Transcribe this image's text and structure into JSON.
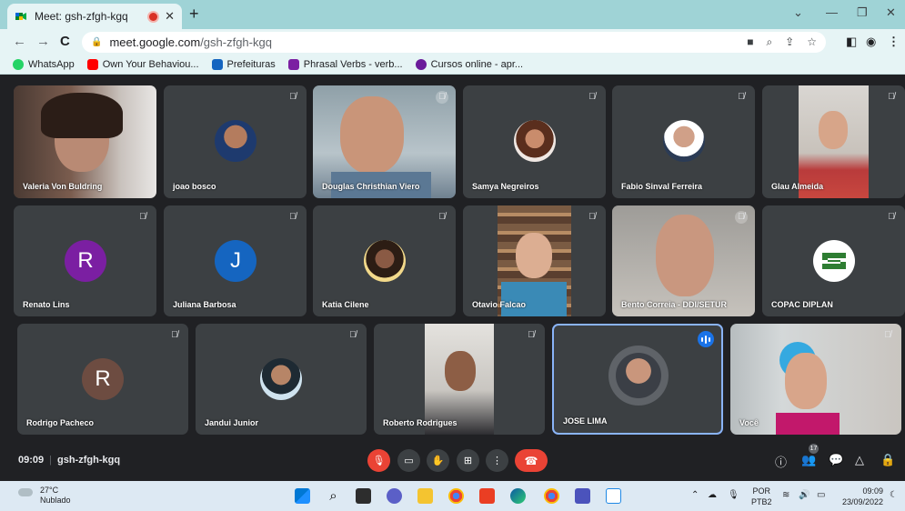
{
  "browser": {
    "tab_title": "Meet: gsh-zfgh-kgq",
    "tab_close": "✕",
    "new_tab": "+",
    "url_host": "meet.google.com",
    "url_path": "/gsh-zfgh-kgq",
    "bookmarks": [
      {
        "label": "WhatsApp",
        "color": "#25d366"
      },
      {
        "label": "Own Your Behaviou...",
        "color": "#ff0000"
      },
      {
        "label": "Prefeituras",
        "color": "#1565c0"
      },
      {
        "label": "Phrasal Verbs - verb...",
        "color": "#7b1fa2"
      },
      {
        "label": "Cursos online - apr...",
        "color": "#6a1b9a"
      }
    ]
  },
  "participants": [
    {
      "name": "Valeria Von Buldring"
    },
    {
      "name": "joao bosco"
    },
    {
      "name": "Douglas Christhian Viero"
    },
    {
      "name": "Samya Negreiros"
    },
    {
      "name": "Fabio Sinval Ferreira"
    },
    {
      "name": "Glau Almeida"
    },
    {
      "name": "Renato Lins",
      "initial": "R",
      "color": "#7b1fa2"
    },
    {
      "name": "Juliana Barbosa",
      "initial": "J",
      "color": "#1565c0"
    },
    {
      "name": "Katia Cilene"
    },
    {
      "name": "Otavio Falcao"
    },
    {
      "name": "Bento Correia - DDI/SETUR"
    },
    {
      "name": "COPAC DIPLAN"
    },
    {
      "name": "Rodrigo Pacheco",
      "initial": "R",
      "color": "#6d4c41"
    },
    {
      "name": "Jandui Junior"
    },
    {
      "name": "Roberto Rodrigues"
    },
    {
      "name": "JOSE LIMA"
    },
    {
      "name": "Você"
    }
  ],
  "meeting": {
    "time": "09:09",
    "code": "gsh-zfgh-kgq",
    "participant_count": "17"
  },
  "taskbar": {
    "temperature": "27°C",
    "condition": "Nublado",
    "lang_1": "POR",
    "lang_2": "PTB2",
    "time": "09:09",
    "date": "23/09/2022"
  }
}
